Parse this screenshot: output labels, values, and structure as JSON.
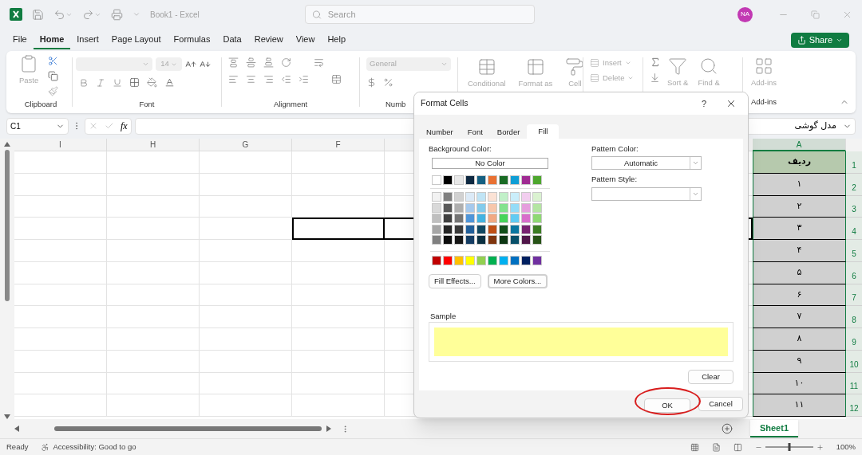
{
  "title_bar": {
    "title": "Book1 - Excel",
    "search": {
      "placeholder": "Search"
    },
    "avatar": "NA"
  },
  "menu_tabs": [
    {
      "label": "File",
      "selected": false
    },
    {
      "label": "Home",
      "selected": true
    },
    {
      "label": "Insert",
      "selected": false
    },
    {
      "label": "Page Layout",
      "selected": false
    },
    {
      "label": "Formulas",
      "selected": false
    },
    {
      "label": "Data",
      "selected": false
    },
    {
      "label": "Review",
      "selected": false
    },
    {
      "label": "View",
      "selected": false
    },
    {
      "label": "Help",
      "selected": false
    }
  ],
  "share_button": "Share",
  "ribbon": {
    "clipboard": {
      "label": "Clipboard",
      "paste": "Paste"
    },
    "font": {
      "label": "Font",
      "size": "14"
    },
    "alignment": {
      "label": "Alignment"
    },
    "number": {
      "label": "Numb",
      "format": "General"
    },
    "styles": {
      "buttons": [
        "Conditional",
        "Format as",
        "Cell"
      ]
    },
    "cells": {
      "buttons": [
        "Insert",
        "Delete"
      ]
    },
    "editing": {
      "buttons": [
        "Sort &",
        "Find &"
      ]
    },
    "addins": {
      "label": "Add-ins",
      "button": "Add-ins"
    }
  },
  "formula_bar": {
    "name_box": "C1",
    "function_label": "fx",
    "content": "مدل گوشی"
  },
  "grid": {
    "columns": [
      {
        "letter": "I",
        "selected": false
      },
      {
        "letter": "H",
        "selected": false
      },
      {
        "letter": "G",
        "selected": false
      },
      {
        "letter": "F",
        "selected": false
      },
      {
        "letter": "A",
        "selected": true
      }
    ],
    "rows": [
      {
        "number": "1",
        "kind": "header",
        "outlined": false,
        "a": "ردیف"
      },
      {
        "number": "2",
        "kind": "data",
        "outlined": false,
        "a": "۱"
      },
      {
        "number": "3",
        "kind": "data",
        "outlined": false,
        "a": "۲"
      },
      {
        "number": "4",
        "kind": "data",
        "outlined": true,
        "a": "۳"
      },
      {
        "number": "5",
        "kind": "data",
        "outlined": false,
        "a": "۴"
      },
      {
        "number": "6",
        "kind": "data",
        "outlined": false,
        "a": "۵"
      },
      {
        "number": "7",
        "kind": "data",
        "outlined": false,
        "a": "۶"
      },
      {
        "number": "8",
        "kind": "data",
        "outlined": false,
        "a": "۷"
      },
      {
        "number": "9",
        "kind": "data",
        "outlined": false,
        "a": "۸"
      },
      {
        "number": "10",
        "kind": "data",
        "outlined": false,
        "a": "۹"
      },
      {
        "number": "11",
        "kind": "data",
        "outlined": false,
        "a": "۱۰"
      },
      {
        "number": "12",
        "kind": "data",
        "outlined": false,
        "a": "۱۱"
      }
    ]
  },
  "sheet_tabs": [
    {
      "label": "Sheet1",
      "selected": true
    }
  ],
  "status_bar": {
    "ready": "Ready",
    "accessibility": "Accessibility: Good to go",
    "zoom_slider": {
      "level": 0.5
    },
    "zoom": "100%"
  },
  "dialog": {
    "title": "Format Cells",
    "help": "?",
    "tabs": [
      {
        "label": "Number",
        "selected": false
      },
      {
        "label": "Font",
        "selected": false
      },
      {
        "label": "Border",
        "selected": false
      },
      {
        "label": "Fill",
        "selected": true
      }
    ],
    "background_color_label": "Background Color:",
    "no_color": "No Color",
    "palette": [
      {
        "kind": "theme",
        "swatches": [
          {
            "color": "#ffffff"
          },
          {
            "color": "#000000"
          },
          {
            "color": "#e8e8e8"
          },
          {
            "color": "#0e2841"
          },
          {
            "color": "#156082"
          },
          {
            "color": "#e97132"
          },
          {
            "color": "#196b24"
          },
          {
            "color": "#0f9ed5"
          },
          {
            "color": "#a02b93"
          },
          {
            "color": "#4ea72e"
          }
        ]
      },
      {
        "kind": "tint",
        "swatches": [
          {
            "color": "#f2f2f2"
          },
          {
            "color": "#808080"
          },
          {
            "color": "#d1d1d1"
          },
          {
            "color": "#dceaf7"
          },
          {
            "color": "#c0e4f5"
          },
          {
            "color": "#fbe2d5"
          },
          {
            "color": "#c1f0c8"
          },
          {
            "color": "#caeefb"
          },
          {
            "color": "#f2ceef"
          },
          {
            "color": "#daf2d0"
          }
        ]
      },
      {
        "kind": "tint",
        "swatches": [
          {
            "color": "#d9d9d9"
          },
          {
            "color": "#595959"
          },
          {
            "color": "#aeaeae"
          },
          {
            "color": "#a6c9ec"
          },
          {
            "color": "#83cbeb"
          },
          {
            "color": "#f7c7ac"
          },
          {
            "color": "#83e28e"
          },
          {
            "color": "#95dcf7"
          },
          {
            "color": "#e59edd"
          },
          {
            "color": "#b4e5a2"
          }
        ]
      },
      {
        "kind": "tint",
        "swatches": [
          {
            "color": "#bfbfbf"
          },
          {
            "color": "#404040"
          },
          {
            "color": "#747474"
          },
          {
            "color": "#4e95d9"
          },
          {
            "color": "#44b3e1"
          },
          {
            "color": "#f1a983"
          },
          {
            "color": "#47d45a"
          },
          {
            "color": "#61cbf3"
          },
          {
            "color": "#d86dcb"
          },
          {
            "color": "#8ed973"
          }
        ]
      },
      {
        "kind": "tint",
        "swatches": [
          {
            "color": "#a6a6a6"
          },
          {
            "color": "#262626"
          },
          {
            "color": "#3a3a3a"
          },
          {
            "color": "#215f9a"
          },
          {
            "color": "#104862"
          },
          {
            "color": "#c04f15"
          },
          {
            "color": "#124f1a"
          },
          {
            "color": "#0b76a0"
          },
          {
            "color": "#782170"
          },
          {
            "color": "#3b7d23"
          }
        ]
      },
      {
        "kind": "tint",
        "swatches": [
          {
            "color": "#808080"
          },
          {
            "color": "#0d0d0d"
          },
          {
            "color": "#171717"
          },
          {
            "color": "#153d63"
          },
          {
            "color": "#0b3041"
          },
          {
            "color": "#7f350e"
          },
          {
            "color": "#0c3512"
          },
          {
            "color": "#074f69"
          },
          {
            "color": "#501549"
          },
          {
            "color": "#275317"
          }
        ]
      },
      {
        "kind": "standard",
        "swatches": [
          {
            "color": "#c00000"
          },
          {
            "color": "#ff0000"
          },
          {
            "color": "#ffc000"
          },
          {
            "color": "#ffff00"
          },
          {
            "color": "#92d050"
          },
          {
            "color": "#00b050"
          },
          {
            "color": "#00b0f0"
          },
          {
            "color": "#0070c0"
          },
          {
            "color": "#002060"
          },
          {
            "color": "#7030a0"
          }
        ]
      }
    ],
    "fill_effects": "Fill Effects...",
    "more_colors": "More Colors...",
    "pattern_color_label": "Pattern Color:",
    "pattern_color": "Automatic",
    "pattern_style_label": "Pattern Style:",
    "sample": {
      "label": "Sample",
      "color": "#ffff99"
    },
    "clear": "Clear",
    "ok": "OK",
    "ok_circled": true,
    "cancel": "Cancel"
  }
}
